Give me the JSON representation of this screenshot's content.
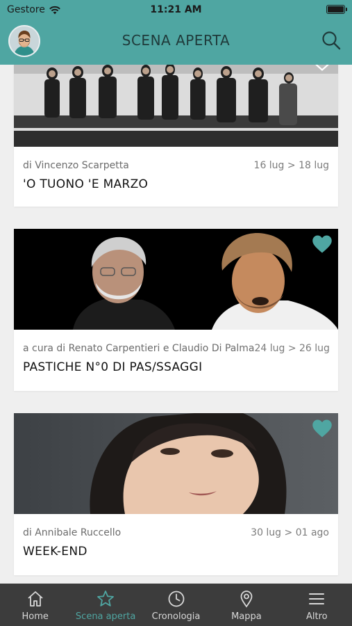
{
  "status_bar": {
    "carrier": "Gestore",
    "time": "11:21 AM"
  },
  "header": {
    "title": "SCENA APERTA"
  },
  "cards": [
    {
      "author": "di Vincenzo Scarpetta",
      "dates": "16 lug > 18 lug",
      "title": "'O TUONO 'E MARZO",
      "favorite": true
    },
    {
      "author": "a cura di Renato Carpentieri e Claudio Di Palma",
      "dates": "24 lug > 26 lug",
      "title": "PASTICHE N°0 DI PAS/SSAGGI",
      "favorite": true
    },
    {
      "author": "di Annibale Ruccello",
      "dates": "30 lug > 01 ago",
      "title": "WEEK-END",
      "favorite": true
    }
  ],
  "tabs": [
    {
      "label": "Home",
      "icon": "home-icon",
      "active": false
    },
    {
      "label": "Scena aperta",
      "icon": "star-icon",
      "active": true
    },
    {
      "label": "Cronologia",
      "icon": "clock-icon",
      "active": false
    },
    {
      "label": "Mappa",
      "icon": "map-pin-icon",
      "active": false
    },
    {
      "label": "Altro",
      "icon": "menu-icon",
      "active": false
    }
  ],
  "colors": {
    "accent": "#4fa6a2",
    "tabbar_bg": "#3c3c3c",
    "page_bg": "#efefef",
    "tab_inactive": "#d8d8d8"
  }
}
